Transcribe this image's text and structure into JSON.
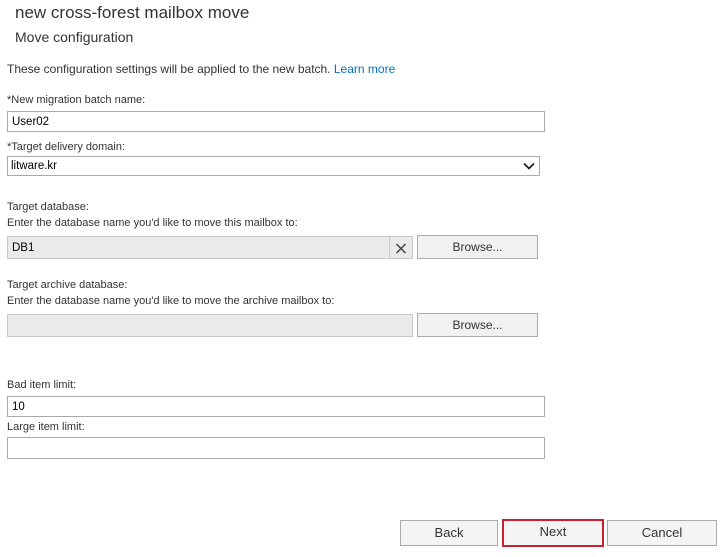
{
  "header": {
    "title": "new cross-forest mailbox move",
    "subtitle": "Move configuration"
  },
  "intro": {
    "text": "These configuration settings will be applied to the new batch.",
    "link": "Learn more"
  },
  "batch_name": {
    "label": "*New migration batch name:",
    "value": "User02"
  },
  "delivery_domain": {
    "label": "*Target delivery domain:",
    "value": "litware.kr"
  },
  "target_database": {
    "label": "Target database:",
    "help": "Enter the database name you'd like to move this mailbox to:",
    "value": "DB1",
    "browse_label": "Browse..."
  },
  "archive_database": {
    "label": "Target archive database:",
    "help": "Enter the database name you'd like to move the archive mailbox to:",
    "value": "",
    "browse_label": "Browse..."
  },
  "bad_item_limit": {
    "label": "Bad item limit:",
    "value": "10"
  },
  "large_item_limit": {
    "label": "Large item limit:",
    "value": ""
  },
  "footer": {
    "back_label": "Back",
    "next_label": "Next",
    "cancel_label": "Cancel"
  }
}
